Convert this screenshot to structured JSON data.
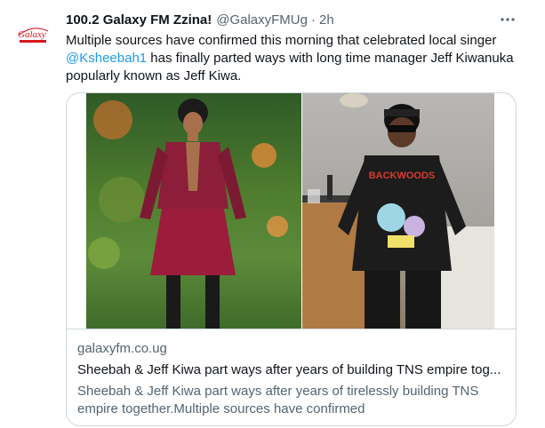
{
  "author": {
    "display_name": "100.2 Galaxy FM Zzina!",
    "handle": "@GalaxyFMUg",
    "separator": "·",
    "time": "2h",
    "avatar_logo_text": "Galaxy"
  },
  "tweet": {
    "text_before_mention": "Multiple sources have confirmed this morning that celebrated local singer ",
    "mention": "@Ksheebah1",
    "text_after_mention": " has finally parted ways with long time manager Jeff Kiwanuka popularly known as Jeff Kiwa."
  },
  "card": {
    "domain": "galaxyfm.co.ug",
    "title": "Sheebah & Jeff Kiwa part ways after years of building TNS empire tog...",
    "description": "Sheebah & Jeff Kiwa part ways after years of tirelessly building TNS empire together.Multiple sources have confirmed",
    "shirt_text": "BACKWOODS"
  },
  "icons": {
    "more": "more-horizontal-icon"
  },
  "colors": {
    "link": "#1d9bf0",
    "secondary_text": "#536471",
    "primary_text": "#0f1419",
    "border": "#cfd9de",
    "logo_red": "#d71920"
  }
}
